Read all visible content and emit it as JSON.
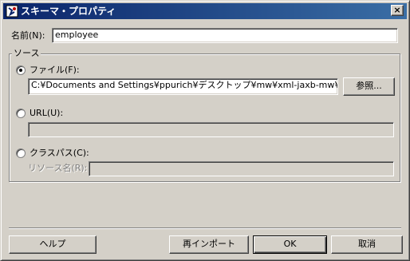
{
  "window": {
    "title": "スキーマ・プロパティ",
    "close_label": "×"
  },
  "name_field": {
    "label": "名前(N):",
    "value": "employee"
  },
  "source_group": {
    "title": "ソース",
    "file": {
      "label": "ファイル(F):",
      "selected": true,
      "value": "C:¥Documents and Settings¥ppurich¥デスクトップ¥mw¥xml-jaxb-mw¥config¥a",
      "browse_label": "参照..."
    },
    "url": {
      "label": "URL(U):",
      "selected": false,
      "value": ""
    },
    "classpath": {
      "label": "クラスパス(C):",
      "selected": false,
      "resource_label": "リソース名(R):",
      "resource_value": ""
    }
  },
  "footer": {
    "help_label": "ヘルプ",
    "reimport_label": "再インポート",
    "ok_label": "OK",
    "cancel_label": "取消"
  }
}
